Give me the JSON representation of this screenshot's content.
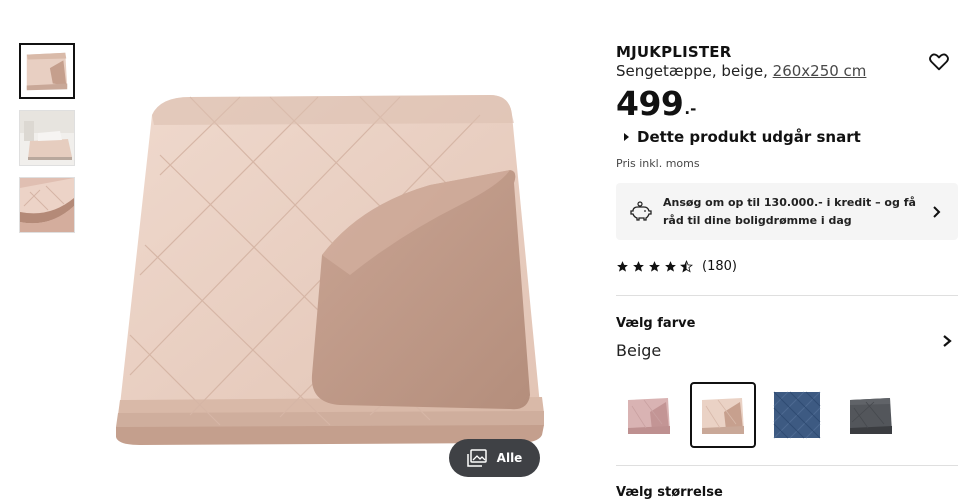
{
  "gallery": {
    "thumbnails": [
      {
        "name": "folded-bedspread",
        "active": true
      },
      {
        "name": "bedroom-scene",
        "active": false
      },
      {
        "name": "fabric-closeup",
        "active": false
      }
    ],
    "view_all_label": "Alle",
    "view_all_icon": "image-gallery-icon"
  },
  "product": {
    "name": "MJUKPLISTER",
    "description": "Sengetæppe, beige,",
    "size_link": "260x250 cm",
    "price": "499",
    "price_suffix": ".-",
    "notice": "Dette produkt udgår snart",
    "vat_text": "Pris inkl. moms",
    "favorite_icon": "heart-outline-icon"
  },
  "credit": {
    "text": "Ansøg om op til 130.000.- i kredit – og få råd til dine boligdrømme i dag",
    "icon": "piggy-bank-icon"
  },
  "rating": {
    "stars": 4.5,
    "count": "(180)"
  },
  "color_selector": {
    "label": "Vælg farve",
    "value": "Beige",
    "swatches": [
      {
        "name": "pink",
        "color": "#d5aeae",
        "selected": false
      },
      {
        "name": "beige",
        "color": "#e6cdbf",
        "selected": true
      },
      {
        "name": "blue",
        "color": "#3d5a82",
        "selected": false
      },
      {
        "name": "dark-grey",
        "color": "#4c4f54",
        "selected": false
      }
    ]
  },
  "size_selector": {
    "label": "Vælg størrelse"
  },
  "colors": {
    "quilt_main": "#e8cfc2",
    "quilt_shadow": "#c9a898",
    "quilt_back": "#c59f8d",
    "button_dark": "#3f4145",
    "panel_bg": "#f5f5f5"
  }
}
